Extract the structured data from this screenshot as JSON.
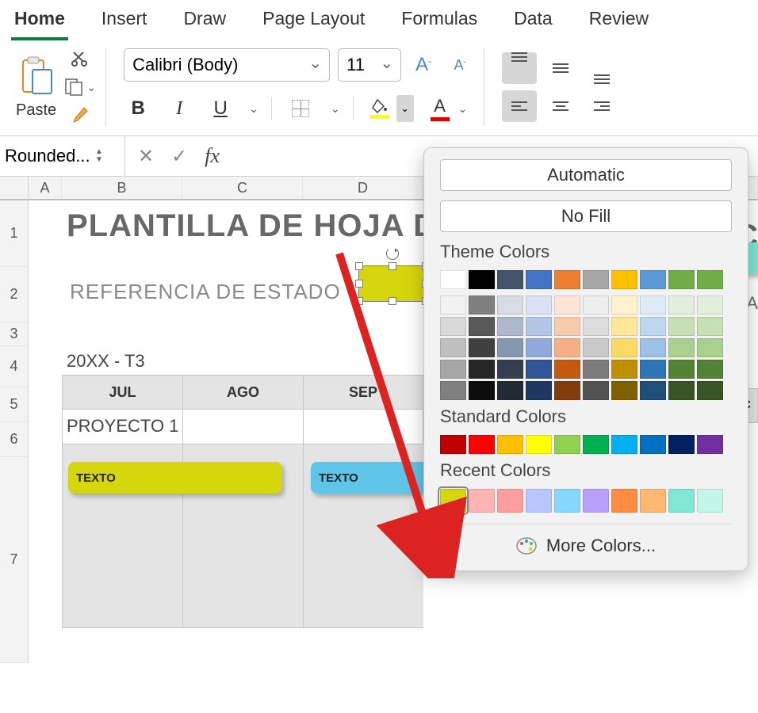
{
  "tabs": {
    "home": "Home",
    "insert": "Insert",
    "draw": "Draw",
    "page_layout": "Page Layout",
    "formulas": "Formulas",
    "data": "Data",
    "review": "Review"
  },
  "clipboard": {
    "paste": "Paste"
  },
  "font": {
    "name": "Calibri (Body)",
    "size": "11"
  },
  "fxbar": {
    "namebox": "Rounded..."
  },
  "sheet": {
    "cols": {
      "A": "A",
      "B": "B",
      "C": "C",
      "D": "D"
    },
    "rows": {
      "r1": "1",
      "r2": "2",
      "r3": "3",
      "r4": "4",
      "r5": "5",
      "r6": "6",
      "r7": "7"
    },
    "title": "PLANTILLA DE HOJA DE",
    "subtitle": "REFERENCIA DE ESTADO",
    "period": "20XX - T3",
    "months": {
      "jul": "JUL",
      "ago": "AGO",
      "sep": "SEP"
    },
    "project1": "PROYECTO 1",
    "bar1": "TEXTO",
    "bar2": "TEXTO",
    "right_title_fragment": "C",
    "right_sub_fragment": "BA",
    "right_month_fragment": "C"
  },
  "popup": {
    "automatic": "Automatic",
    "nofill": "No Fill",
    "theme_label": "Theme Colors",
    "standard_label": "Standard Colors",
    "recent_label": "Recent Colors",
    "more": "More Colors...",
    "theme_top": [
      "#ffffff",
      "#000000",
      "#44546a",
      "#4472c4",
      "#ed7d31",
      "#a5a5a5",
      "#ffc000",
      "#5b9bd5",
      "#70ad47",
      "#70ad47"
    ],
    "theme_shades": [
      [
        "#f2f2f2",
        "#7f7f7f",
        "#d6dce5",
        "#d9e1f2",
        "#fce4d6",
        "#ededed",
        "#fff2cc",
        "#ddebf7",
        "#e2efda",
        "#e2efda"
      ],
      [
        "#d9d9d9",
        "#595959",
        "#adb9ca",
        "#b4c6e7",
        "#f8cbad",
        "#dbdbdb",
        "#ffe699",
        "#bdd7ee",
        "#c6e0b4",
        "#c6e0b4"
      ],
      [
        "#bfbfbf",
        "#404040",
        "#8497b0",
        "#8ea9db",
        "#f4b084",
        "#c9c9c9",
        "#ffd966",
        "#9bc2e6",
        "#a9d08e",
        "#a9d08e"
      ],
      [
        "#a6a6a6",
        "#262626",
        "#333f4f",
        "#305496",
        "#c65911",
        "#7b7b7b",
        "#bf8f00",
        "#2f75b5",
        "#548235",
        "#548235"
      ],
      [
        "#808080",
        "#0d0d0d",
        "#222b35",
        "#203764",
        "#833c0c",
        "#525252",
        "#806000",
        "#1f4e78",
        "#375623",
        "#375623"
      ]
    ],
    "standard": [
      "#c00000",
      "#ff0000",
      "#ffc000",
      "#ffff00",
      "#92d050",
      "#00b050",
      "#00b0f0",
      "#0070c0",
      "#002060",
      "#7030a0"
    ],
    "recent": [
      "#d6d60e",
      "#ffb3b3",
      "#ff9e9e",
      "#b8c6ff",
      "#87d8ff",
      "#b9a0ff",
      "#ff8c42",
      "#ffb870",
      "#7fe7d4",
      "#c4f5e9"
    ]
  }
}
